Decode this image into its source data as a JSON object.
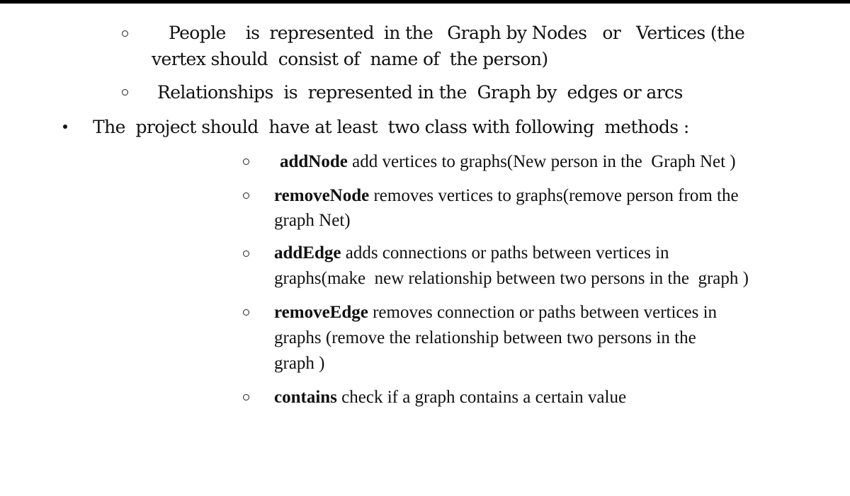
{
  "top_sub_bullets": [
    {
      "line1": [
        "People",
        "is",
        "represented",
        "in the",
        "Graph by Nodes",
        "or",
        "Vertices (the"
      ],
      "line2": "vertex should  consist of  name of  the person)"
    },
    {
      "line1": "Relationships  is  represented in the  Graph by  edges or arcs"
    }
  ],
  "main_bullet": {
    "text": "The  project should  have at least  two class with following  methods :"
  },
  "methods": [
    {
      "name": "addNode",
      "lines": [
        " add vertices to graphs(New person in the  Graph Net )"
      ]
    },
    {
      "name": "removeNode",
      "lines": [
        " removes vertices to graphs(remove person from the",
        "graph Net)"
      ]
    },
    {
      "name": "addEdge",
      "lines": [
        " adds connections or paths between vertices in",
        "graphs(make  new relationship between two persons in the  graph )"
      ]
    },
    {
      "name": "removeEdge",
      "lines": [
        " removes connection or paths between vertices in",
        "graphs (remove the relationship between two persons in the",
        "graph )"
      ]
    },
    {
      "name": "contains",
      "lines": [
        " check if a graph contains a certain value"
      ]
    }
  ]
}
